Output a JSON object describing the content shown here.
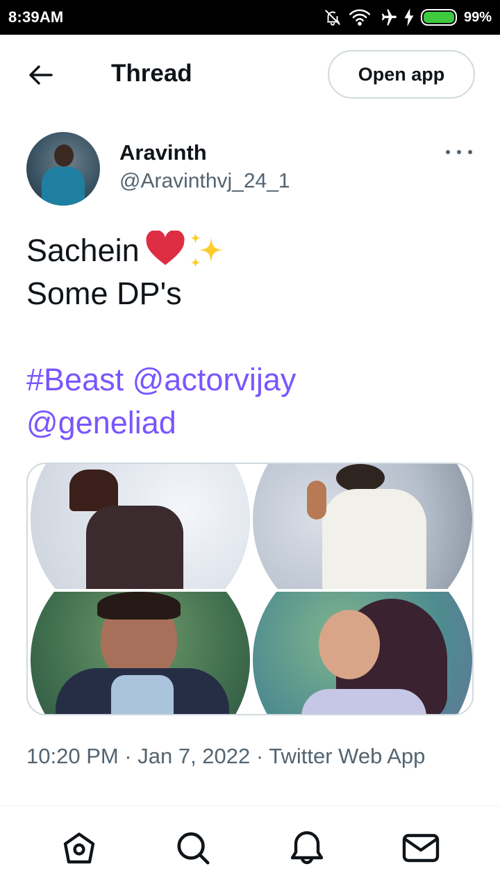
{
  "status_bar": {
    "time": "8:39AM",
    "battery_percent": "99%",
    "battery_level": 0.99,
    "icons": [
      "bell-off-icon",
      "wifi-icon",
      "airplane-icon",
      "charging-icon",
      "battery-icon"
    ]
  },
  "header": {
    "back_icon": "arrow-left-icon",
    "title": "Thread",
    "open_app_label": "Open app"
  },
  "tweet": {
    "author": {
      "name": "Aravinth",
      "handle": "@Aravinthvj_24_1"
    },
    "text_line1": "Sachein",
    "text_line2": "Some DP's",
    "hashtag": "#Beast",
    "mention1": "@actorvijay",
    "mention2": "@geneliad",
    "emoji": [
      "red-heart-icon",
      "sparkles-icon"
    ],
    "timestamp": "10:20 PM · Jan 7, 2022 · Twitter Web App"
  },
  "bottom_nav": {
    "items": [
      "home-icon",
      "search-icon",
      "notifications-icon",
      "messages-icon"
    ]
  },
  "colors": {
    "link": "#7856ff",
    "secondary_text": "#536471",
    "border": "#cfd9de"
  }
}
